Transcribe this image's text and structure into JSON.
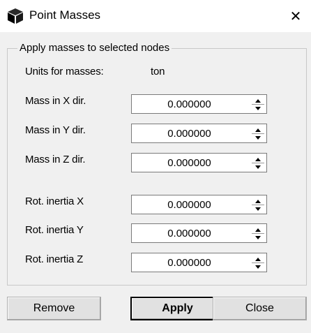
{
  "window": {
    "title": "Point Masses",
    "close_glyph": "✕",
    "icon": "cube-icon"
  },
  "group": {
    "label": "Apply masses to selected nodes",
    "units_label": "Units for masses:",
    "units_value": "ton"
  },
  "fields": [
    {
      "label": "Mass in X dir.",
      "value": "0.000000"
    },
    {
      "label": "Mass in Y dir.",
      "value": "0.000000"
    },
    {
      "label": "Mass in Z dir.",
      "value": "0.000000"
    },
    {
      "label": "Rot. inertia X",
      "value": "0.000000"
    },
    {
      "label": "Rot. inertia Y",
      "value": "0.000000"
    },
    {
      "label": "Rot. inertia Z",
      "value": "0.000000"
    }
  ],
  "buttons": {
    "remove": "Remove",
    "apply": "Apply",
    "close": "Close"
  }
}
